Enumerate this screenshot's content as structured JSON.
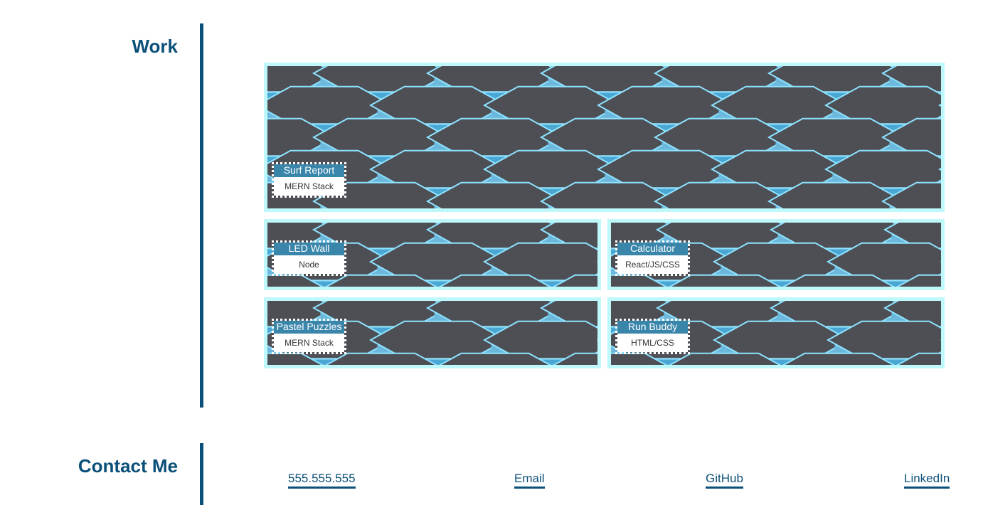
{
  "work": {
    "title": "Work",
    "projects": [
      {
        "title": "Surf Report",
        "tech": "MERN Stack"
      },
      {
        "title": "LED Wall",
        "tech": "Node"
      },
      {
        "title": "Calculator",
        "tech": "React/JS/CSS"
      },
      {
        "title": "Pastel Puzzles",
        "tech": "MERN Stack"
      },
      {
        "title": "Run Buddy",
        "tech": "HTML/CSS"
      }
    ]
  },
  "contact": {
    "title": "Contact Me",
    "links": [
      "555.555.555",
      "Email",
      "GitHub",
      "LinkedIn"
    ]
  },
  "colors": {
    "heading": "#0b5079",
    "card_border": "#bff8fb",
    "label_bg": "#3a86ab"
  }
}
